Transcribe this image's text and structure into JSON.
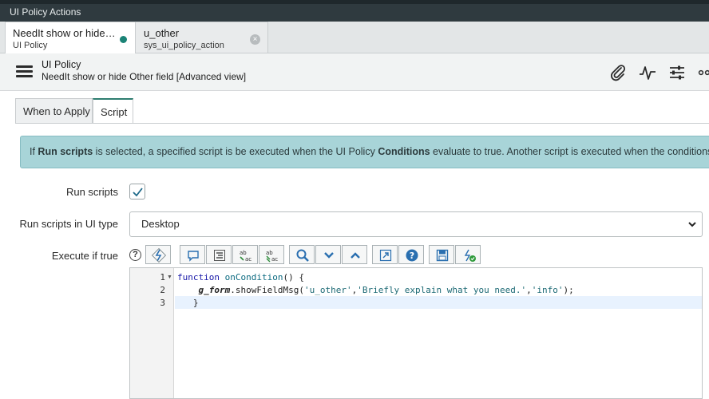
{
  "window": {
    "title": "UI Policy Actions"
  },
  "tabs": [
    {
      "title": "NeedIt show or hide…",
      "subtitle": "UI Policy"
    },
    {
      "title": "u_other",
      "subtitle": "sys_ui_policy_action"
    }
  ],
  "header": {
    "title": "UI Policy",
    "subtitle": "NeedIt show or hide Other field [Advanced view]"
  },
  "form_tabs": [
    "When to Apply",
    "Script"
  ],
  "info": {
    "part1": "If ",
    "bold1": "Run scripts",
    "part2": " is selected, a specified script is be executed when the UI Policy ",
    "bold2": "Conditions",
    "part3": " evaluate to true. Another script is executed when the conditions evaluate to false."
  },
  "fields": {
    "run_scripts_label": "Run scripts",
    "run_scripts_checked": true,
    "ui_type_label": "Run scripts in UI type",
    "ui_type_value": "Desktop",
    "execute_label": "Execute if true",
    "help_glyph": "?"
  },
  "editor": {
    "lines": [
      "1",
      "2",
      "3"
    ],
    "line1_kw": "function",
    "line1_fn": " onCondition",
    "line1_rest": "() {",
    "line2_indent": "    ",
    "line2_obj": "g_form",
    "line2_method": ".showFieldMsg(",
    "line2_arg1": "'u_other'",
    "line2_comma1": ",",
    "line2_arg2": "'Briefly explain what you need.'",
    "line2_comma2": ",",
    "line2_arg3": "'info'",
    "line2_end": ");",
    "line3": "   }"
  },
  "icons": [
    "menu-icon",
    "paperclip-icon",
    "activity-icon",
    "sliders-icon",
    "more-icon",
    "check-icon",
    "help-icon",
    "script-toggle-icon",
    "comment-icon",
    "format-icon",
    "replace-icon",
    "replace-all-icon",
    "search-icon",
    "expand-icon",
    "collapse-icon",
    "fullscreen-icon",
    "help-circle-icon",
    "save-icon",
    "syntax-check-icon"
  ],
  "colors": {
    "accent": "#1b8376",
    "info_bg": "#a8d4d8",
    "titlebar": "#2f3a3f"
  }
}
